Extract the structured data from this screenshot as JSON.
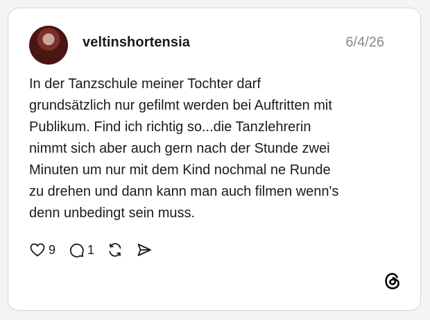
{
  "post": {
    "username": "veltinshortensia",
    "date": "6/4/26",
    "text_lines": [
      "In der Tanzschule meiner Tochter darf",
      "grundsätzlich nur gefilmt werden bei Auftritten mit",
      "Publikum. Find ich richtig so...die Tanzlehrerin",
      "nimmt sich aber auch gern nach der Stunde zwei",
      "Minuten um nur mit dem Kind nochmal ne Runde",
      "zu drehen und dann kann man auch filmen wenn's",
      "denn unbedingt sein muss."
    ]
  },
  "actions": {
    "like_icon": "heart-icon",
    "like_count": "9",
    "reply_icon": "speech-bubble-icon",
    "reply_count": "1",
    "repost_icon": "repost-arrows-icon",
    "share_icon": "send-arrow-icon"
  },
  "brand": {
    "logo_icon": "threads-logo-icon"
  },
  "colors": {
    "text": "#1a1a1a",
    "muted": "#8a8a8a",
    "card_border": "#d6d6d6",
    "background": "#ffffff"
  }
}
